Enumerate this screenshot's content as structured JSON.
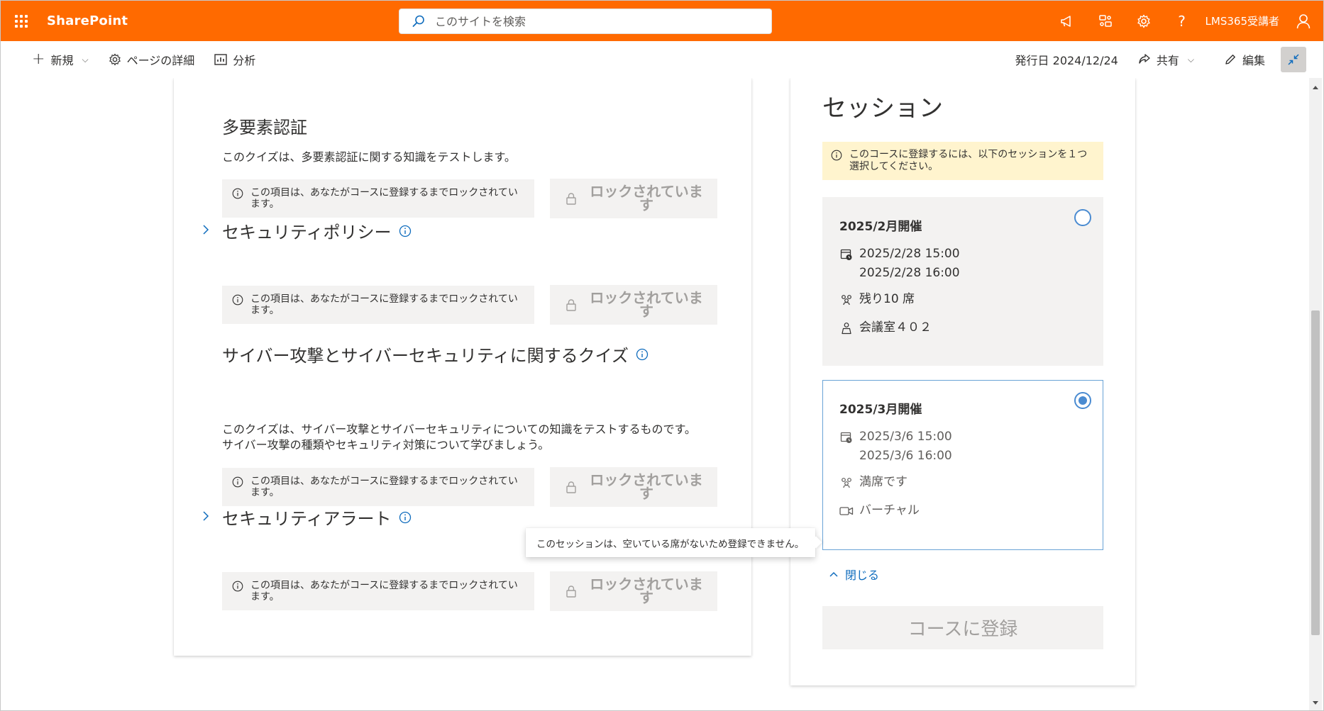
{
  "suitebar": {
    "brand": "SharePoint",
    "search_placeholder": "このサイトを検索",
    "user_name": "LMS365受講者",
    "bg_color": "#ff6a00"
  },
  "cmdbar": {
    "new_label": "新規",
    "page_details_label": "ページの詳細",
    "analytics_label": "分析",
    "published_label": "発行日 2024/12/24",
    "share_label": "共有",
    "edit_label": "編集"
  },
  "modules": [
    {
      "title": "多要素認証",
      "description": "このクイズは、多要素認証に関する知識をテストします。",
      "lock_notice": "この項目は、あなたがコースに登録するまでロックされています。",
      "lock_button": "ロックされています",
      "expandable": false
    },
    {
      "title": "セキュリティポリシー",
      "lock_notice": "この項目は、あなたがコースに登録するまでロックされています。",
      "lock_button": "ロックされています",
      "expandable": true
    },
    {
      "title": "サイバー攻撃とサイバーセキュリティに関するクイズ",
      "description": "このクイズは、サイバー攻撃とサイバーセキュリティについての知識をテストするものです。サイバー攻撃の種類やセキュリティ対策について学びましょう。",
      "lock_notice": "この項目は、あなたがコースに登録するまでロックされています。",
      "lock_button": "ロックされています",
      "expandable": false
    },
    {
      "title": "セキュリティアラート",
      "lock_notice": "この項目は、あなたがコースに登録するまでロックされています。",
      "lock_button": "ロックされています",
      "expandable": true
    }
  ],
  "sessions_panel": {
    "title": "セッション",
    "notice": "このコースに登録するには、以下のセッションを１つ選択してください。",
    "sessions": [
      {
        "title": "2025/2月開催",
        "start": "2025/2/28 15:00",
        "end": "2025/2/28 16:00",
        "seats": "残り10 席",
        "location": "会議室４０２",
        "selected": false
      },
      {
        "title": "2025/3月開催",
        "start": "2025/3/6 15:00",
        "end": "2025/3/6 16:00",
        "seats": "満席です",
        "location": "バーチャル",
        "selected": true
      }
    ],
    "close_label": "閉じる",
    "register_label": "コースに登録",
    "tooltip": "このセッションは、空いている席がないため登録できません。"
  }
}
